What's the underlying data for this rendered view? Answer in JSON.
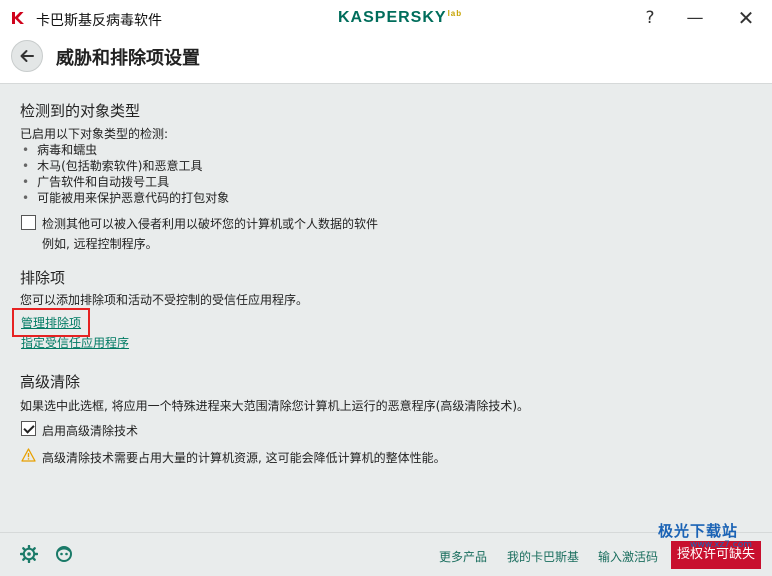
{
  "window": {
    "app_title": "卡巴斯基反病毒软件",
    "brand": "KASPERSKY",
    "brand_suffix": "lab",
    "help": "?",
    "minimize": "—",
    "close": "✕"
  },
  "header": {
    "title": "威胁和排除项设置"
  },
  "detected": {
    "title": "检测到的对象类型",
    "intro": "已启用以下对象类型的检测:",
    "items": [
      "病毒和蠕虫",
      "木马(包括勒索软件)和恶意工具",
      "广告软件和自动拨号工具",
      "可能被用来保护恶意代码的打包对象"
    ],
    "option_label": "检测其他可以被入侵者利用以破坏您的计算机或个人数据的软件",
    "option_checked": false,
    "option_example": "例如, 远程控制程序。"
  },
  "exclusions": {
    "title": "排除项",
    "description": "您可以添加排除项和活动不受控制的受信任应用程序。",
    "manage_link": "管理排除项",
    "trusted_link": "指定受信任应用程序"
  },
  "advanced": {
    "title": "高级清除",
    "description": "如果选中此选框, 将应用一个特殊进程来大范围清除您计算机上运行的恶意程序(高级清除技术)。",
    "option_label": "启用高级清除技术",
    "option_checked": true,
    "warning": "高级清除技术需要占用大量的计算机资源, 这可能会降低计算机的整体性能。"
  },
  "footer": {
    "more_products": "更多产品",
    "my_kaspersky": "我的卡巴斯基",
    "enter_code": "输入激活码",
    "license_button": "授权许可缺失"
  },
  "watermark": {
    "text": "极光下载站",
    "sub": "www.xz7.com"
  },
  "colors": {
    "accent": "#007a63",
    "license": "#c8102e",
    "highlight": "#e62222",
    "warning": "#e8a000"
  }
}
